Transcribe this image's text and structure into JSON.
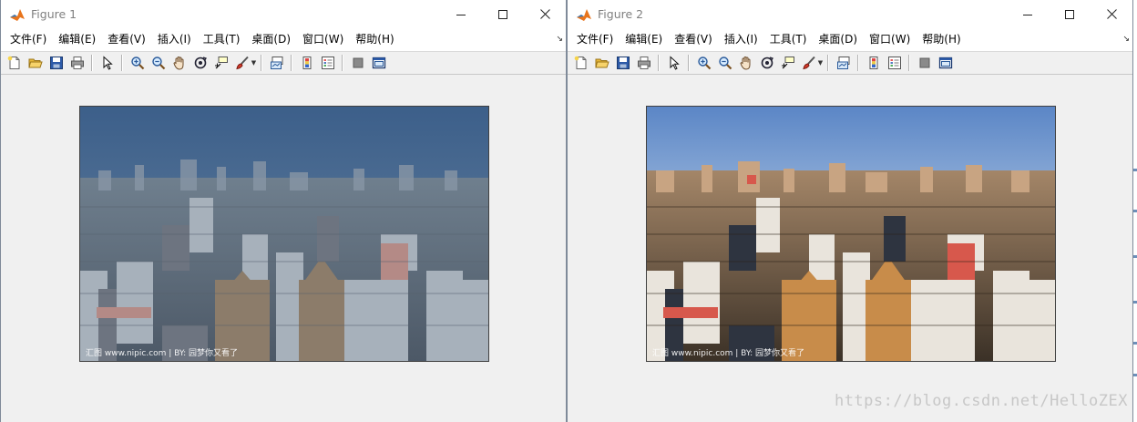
{
  "figures": [
    {
      "title": "Figure 1",
      "menu": [
        "文件(F)",
        "编辑(E)",
        "查看(V)",
        "插入(I)",
        "工具(T)",
        "桌面(D)",
        "窗口(W)",
        "帮助(H)"
      ],
      "image_watermark": "汇图  www.nipic.com  |  BY: 园梦你又看了"
    },
    {
      "title": "Figure 2",
      "menu": [
        "文件(F)",
        "编辑(E)",
        "查看(V)",
        "插入(I)",
        "工具(T)",
        "桌面(D)",
        "窗口(W)",
        "帮助(H)"
      ],
      "image_watermark": "汇图  www.nipic.com  |  BY: 园梦你又看了"
    }
  ],
  "toolbar_icons": [
    "new-figure-icon",
    "open-file-icon",
    "save-icon",
    "print-icon",
    "edit-plot-arrow-icon",
    "zoom-in-icon",
    "zoom-out-icon",
    "pan-hand-icon",
    "rotate-3d-icon",
    "data-cursor-icon",
    "brush-icon",
    "link-plot-icon",
    "colorbar-icon",
    "legend-icon",
    "hide-plot-tools-icon",
    "show-plot-tools-icon"
  ],
  "blog_watermark": "https://blog.csdn.net/HelloZEX",
  "colors": {
    "figure_background": "#f0f0f0",
    "titlebar": "#ffffff",
    "matlab_orange": "#e8741c"
  }
}
